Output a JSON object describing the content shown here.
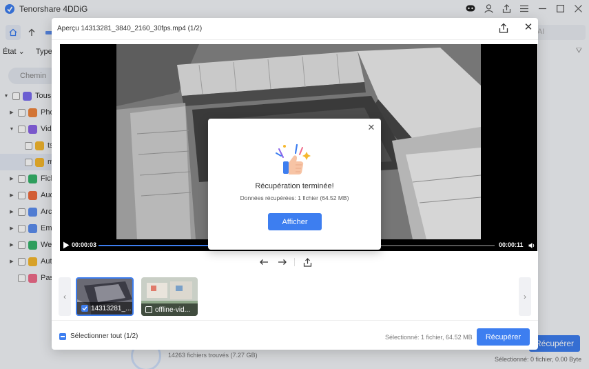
{
  "app": {
    "title": "Tenorshare 4DDiG",
    "search_placeholder": "AI"
  },
  "filters": {
    "state": "État",
    "type": "Type"
  },
  "sidebar": {
    "path_chip": "Chemin",
    "tree": [
      {
        "label": "Tous l",
        "icon": "all-files-icon",
        "color": "#7a6cf0"
      },
      {
        "label": "Pho",
        "icon": "photo-icon",
        "color": "#f0843d"
      },
      {
        "label": "Vide",
        "icon": "video-icon",
        "color": "#8a63e8"
      },
      {
        "label": "ts",
        "icon": "folder-icon",
        "color": "#f5b82e"
      },
      {
        "label": "m",
        "icon": "folder-icon",
        "color": "#f5b82e"
      },
      {
        "label": "Fichi",
        "icon": "document-icon",
        "color": "#35b46a"
      },
      {
        "label": "Aud",
        "icon": "audio-icon",
        "color": "#f06b3d"
      },
      {
        "label": "Arch",
        "icon": "archive-icon",
        "color": "#5c8ef0"
      },
      {
        "label": "Ema",
        "icon": "email-icon",
        "color": "#5c8ef0"
      },
      {
        "label": "Wel",
        "icon": "web-icon",
        "color": "#35b46a"
      },
      {
        "label": "Auti",
        "icon": "other-icon",
        "color": "#f5b82e"
      },
      {
        "label": "Pas",
        "icon": "unknown-icon",
        "color": "#f06b8a"
      }
    ]
  },
  "background_footer": {
    "found": "14263 fichiers trouvés (7.27 GB)",
    "recover_label": "Récupérer",
    "selected": "Sélectionné: 0 fichier, 0.00 Byte"
  },
  "preview": {
    "title": "Aperçu 14313281_3840_2160_30fps.mp4 (1/2)",
    "time_current": "00:00:03",
    "time_total": "00:00:11",
    "progress": 0.285,
    "thumbnails": [
      {
        "label": "14313281_...",
        "checked": true
      },
      {
        "label": "offline-vid...",
        "checked": false
      }
    ],
    "select_all": "Sélectionner tout (1/2)",
    "selected_info": "Sélectionné: 1 fichier, 64.52 MB",
    "recover_label": "Récupérer"
  },
  "completion": {
    "title": "Récupération terminée!",
    "subtitle": "Données récupérées: 1 fichier (64.52 MB)",
    "button": "Afficher"
  },
  "colors": {
    "accent": "#3d7ef0",
    "overlay": "rgba(0,0,0,0.12)"
  }
}
